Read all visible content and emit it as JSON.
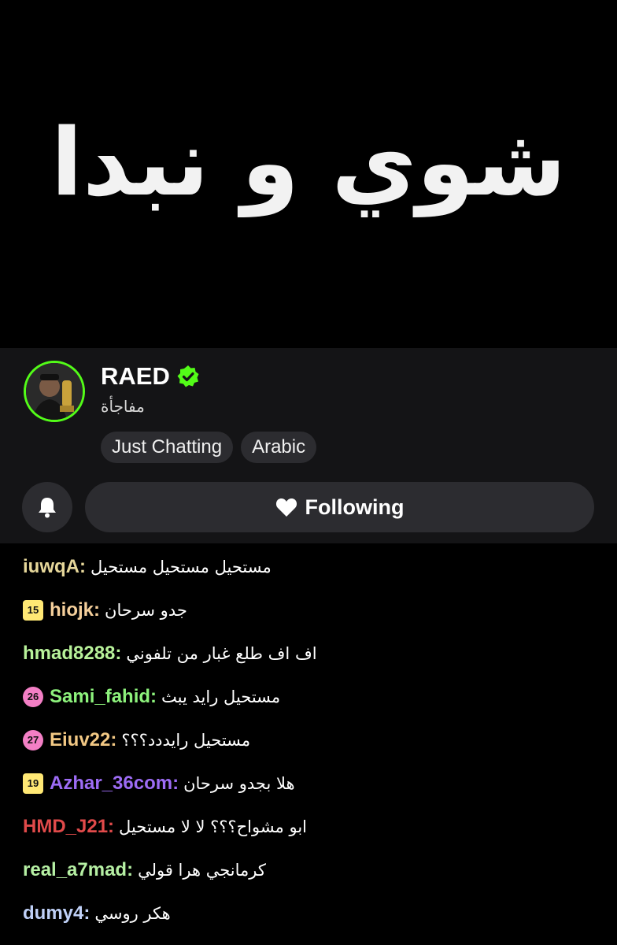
{
  "video": {
    "overlay_text": "شوي و نبدا"
  },
  "channel": {
    "name": "RAED",
    "subtitle": "مفاجأة",
    "tags": [
      "Just Chatting",
      "Arabic"
    ],
    "follow_label": "Following",
    "accent": "#53fc18"
  },
  "chat": [
    {
      "user": "iuwqA",
      "color": "#e6d79a",
      "badge": null,
      "badge_style": null,
      "text": "مستحيل مستحيل مستحيل"
    },
    {
      "user": "hiojk",
      "color": "#f5cf9b",
      "badge": "15",
      "badge_style": "sq",
      "text": "جدو سرحان"
    },
    {
      "user": "hmad8288",
      "color": "#b8f29a",
      "badge": null,
      "badge_style": null,
      "text": "اف اف طلع غبار من تلفوني"
    },
    {
      "user": "Sami_fahid",
      "color": "#8df27c",
      "badge": "26",
      "badge_style": "hex",
      "text": "مستحيل رايد يبث"
    },
    {
      "user": "Eiuv22",
      "color": "#f2c884",
      "badge": "27",
      "badge_style": "hex",
      "text": "مستحيل رايددد؟؟؟"
    },
    {
      "user": "Azhar_36com",
      "color": "#9d6cf5",
      "badge": "19",
      "badge_style": "sq",
      "text": "هلا بجدو سرحان"
    },
    {
      "user": "HMD_J21",
      "color": "#e04a4a",
      "badge": null,
      "badge_style": null,
      "text": "ابو مشواح؟؟؟ لا لا مستحيل"
    },
    {
      "user": "real_a7mad",
      "color": "#b6f0a4",
      "badge": null,
      "badge_style": null,
      "text": "كرمانجي هرا قولي"
    },
    {
      "user": "dumy4",
      "color": "#bfd0f7",
      "badge": null,
      "badge_style": null,
      "text": "هكر روسي"
    }
  ]
}
